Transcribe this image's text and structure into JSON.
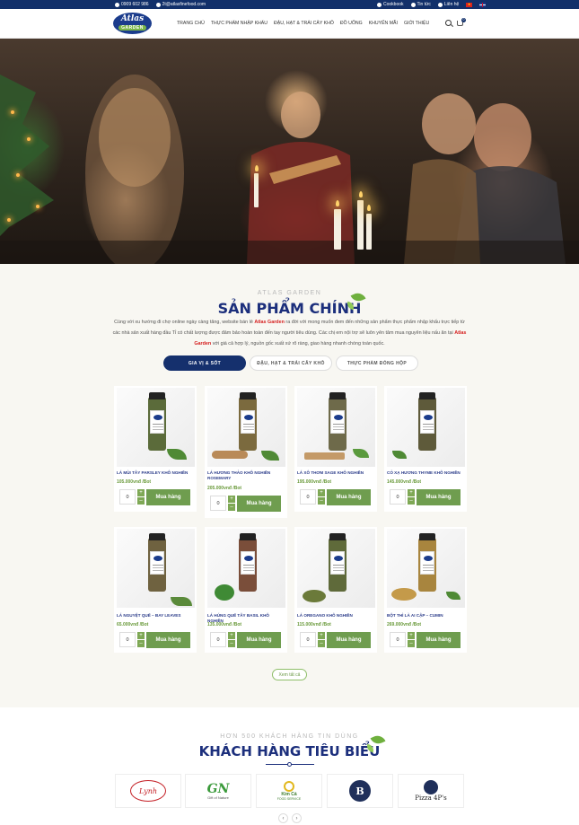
{
  "topbar": {
    "phone": "0909 602 986",
    "email": "2t@atlasfinefood.com",
    "links": [
      "Cookbook",
      "Tin tức",
      "Liên hệ"
    ]
  },
  "header": {
    "logo_main": "Atlas",
    "logo_sub": "GARDEN",
    "nav": [
      "TRANG CHỦ",
      "THỰC PHẨM NHẬP KHẨU",
      "ĐẬU, HẠT & TRÁI CÂY KHÔ",
      "ĐỒ UỐNG",
      "KHUYẾN MÃI",
      "GIỚI THIỆU"
    ],
    "cart_count": "0"
  },
  "products_section": {
    "subtitle": "ATLAS GARDEN",
    "title": "SẢN PHẨM CHÍNH",
    "intro_1": "Cùng với xu hướng đi chợ online ngày càng tăng, website bán lẻ",
    "intro_brand_1": "Atlas Garden",
    "intro_2": "ra đời với mong muốn đem đến những sản phẩm thực phẩm nhập khẩu trực tiếp từ các nhà sản xuất hàng đầu Tỉ có chất lượng được đảm bảo hoàn toàn đến tay người tiêu dùng. Các chị em nội trợ sẽ luôn yên tâm mua nguyên liệu nấu ăn tại",
    "intro_brand_2": "Atlas Garden",
    "intro_3": "với giá cả hợp lý, nguồn gốc xuất xứ rõ ràng, giao hàng nhanh chóng toàn quốc.",
    "tabs": [
      "GIA VỊ & SỐT",
      "ĐẬU, HẠT & TRÁI CÂY KHÔ",
      "THỰC PHẨM ĐÓNG HỘP"
    ],
    "products": [
      {
        "name": "LÁ MÙI TÂY PARSLEY KHÔ NGHIỀN",
        "price": "105.000vnđ /Bot",
        "qty": "0"
      },
      {
        "name": "LÁ HƯƠNG THẢO KHÔ NGHIỀN ROSEMARY",
        "price": "205.000vnđ /Bot",
        "qty": "0"
      },
      {
        "name": "LÁ XÔ THƠM SAGE KHÔ NGHIỀN",
        "price": "195.000vnđ /Bot",
        "qty": "0"
      },
      {
        "name": "CỎ XẠ HƯƠNG THYME KHÔ NGHIỀN",
        "price": "145.000vnđ /Bot",
        "qty": "0"
      },
      {
        "name": "LÁ NGUYỆT QUẾ – BAY LEAVES",
        "price": "65.000vnđ /Bot",
        "qty": "0"
      },
      {
        "name": "LÁ HÚNG QUẾ TÂY BASIL KHÔ NGHIỀN",
        "price": "135.000vnđ /Bot",
        "qty": "0"
      },
      {
        "name": "LÁ OREGANO KHÔ NGHIỀN",
        "price": "115.000vnđ /Bot",
        "qty": "0"
      },
      {
        "name": "BỘT THÌ LÀ AI CẬP – CUMIN",
        "price": "269.000vnđ /Bot",
        "qty": "0"
      }
    ],
    "buy_label": "Mua hàng",
    "plus": "+",
    "minus": "–",
    "view_all": "Xem tất cả"
  },
  "clients_section": {
    "subtitle": "HƠN 500 KHÁCH HÀNG TIN DÙNG",
    "title": "KHÁCH HÀNG TIÊU BIỂU",
    "logos": [
      {
        "text": "Lynh"
      },
      {
        "text": "GN",
        "tagline": "Gift of Nature"
      },
      {
        "text": "Kim Cả",
        "tagline": "FOOD SERVICE"
      },
      {
        "text": "B"
      },
      {
        "text": "Pizza 4P's"
      }
    ],
    "prev": "‹",
    "next": "›"
  },
  "colors": {
    "navy": "#12306a",
    "title_blue": "#1c2f7c",
    "green": "#6f9d4f",
    "brand_red": "#d51f1f"
  }
}
